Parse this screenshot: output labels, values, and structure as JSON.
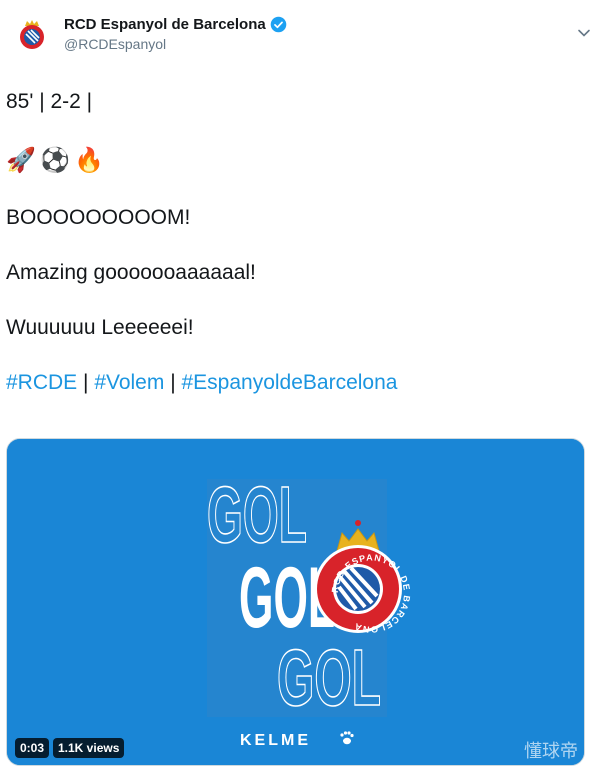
{
  "account": {
    "name": "RCD Espanyol de Barcelona",
    "handle": "@RCDEspanyol",
    "verified": true,
    "avatar_icon": "espanyol-crest-icon"
  },
  "menu_icon": "chevron-down-icon",
  "tweet": {
    "line1": "85' | 2-2 |",
    "emojis": [
      "🚀",
      "⚽",
      "🔥"
    ],
    "emoji_names": [
      "rocket-icon",
      "soccer-ball-icon",
      "fire-icon"
    ],
    "line2": "BOOOOOOOOOM!",
    "line3": "Amazing gooooooaaaaaal!",
    "line4": "Wuuuuuu Leeeeeei!",
    "hashtags": [
      "#RCDE",
      "#Volem",
      "#EspanyoldeBarcelona"
    ],
    "separator": " | "
  },
  "media": {
    "gol_texts": [
      "GOL",
      "GOL",
      "GOL"
    ],
    "crest_text": "RCD ESPANYOL DE BARCELONA",
    "sponsor": "KELME",
    "time": "0:03",
    "views": "1.1K views",
    "watermark": "懂球帝"
  },
  "colors": {
    "link": "#1b95e0",
    "media_bg": "#1a86d6",
    "verified": "#1da1f2",
    "crest_red": "#d8232a",
    "crown_gold": "#e8b21f"
  }
}
